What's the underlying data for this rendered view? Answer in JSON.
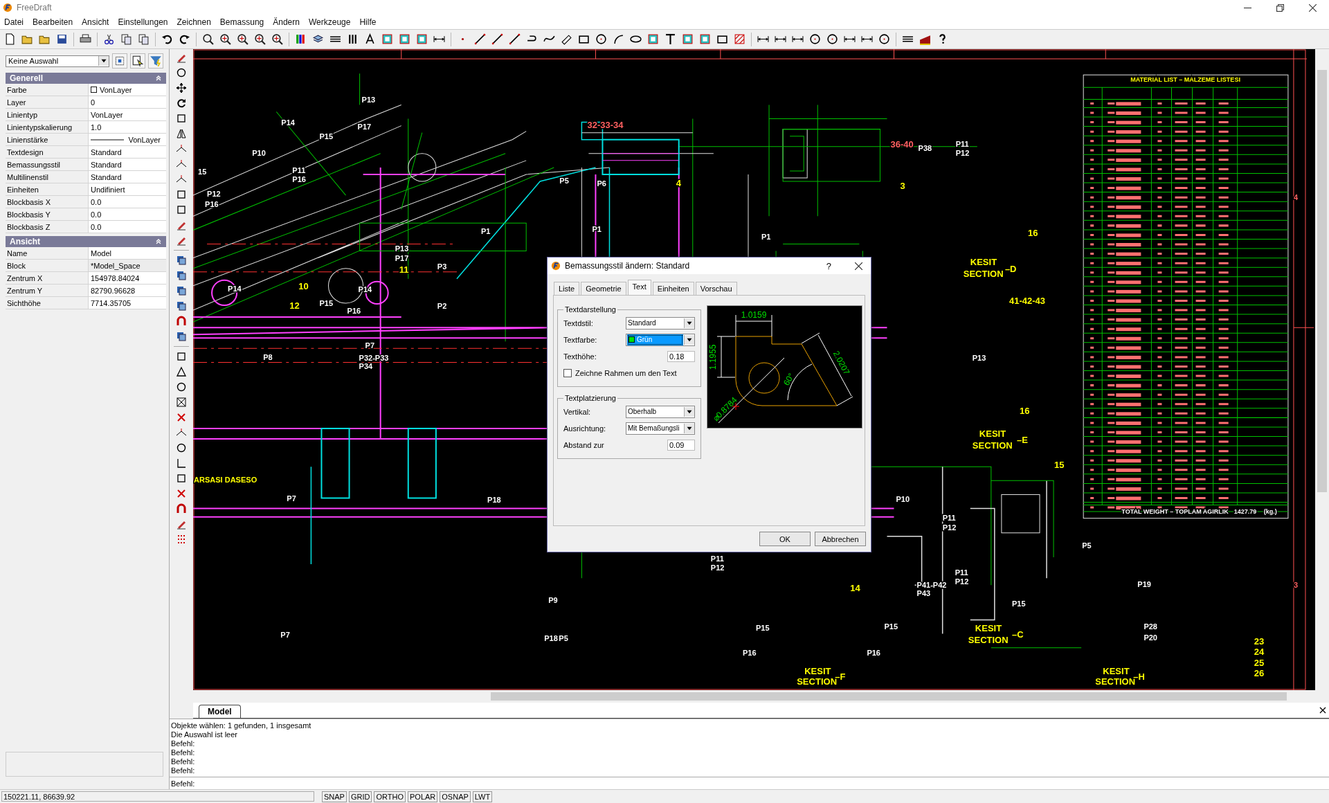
{
  "window": {
    "title": "FreeDraft"
  },
  "menu": [
    "Datei",
    "Bearbeiten",
    "Ansicht",
    "Einstellungen",
    "Zeichnen",
    "Bemassung",
    "Ändern",
    "Werkzeuge",
    "Hilfe"
  ],
  "selection_dropdown": {
    "value": "Keine Auswahl"
  },
  "properties": {
    "sections": [
      {
        "title": "Generell",
        "expanded": true,
        "rows": [
          {
            "label": "Farbe",
            "value": "VonLayer",
            "kind": "color"
          },
          {
            "label": "Layer",
            "value": "0",
            "kind": "text"
          },
          {
            "label": "Linientyp",
            "value": "VonLayer",
            "kind": "text"
          },
          {
            "label": "Linientypskalierung",
            "value": "1.0",
            "kind": "text"
          },
          {
            "label": "Linienstärke",
            "value": "VonLayer",
            "kind": "lineweight"
          },
          {
            "label": "Textdesign",
            "value": "Standard",
            "kind": "text"
          },
          {
            "label": "Bemassungsstil",
            "value": "Standard",
            "kind": "text"
          },
          {
            "label": "Multilinenstil",
            "value": "Standard",
            "kind": "text"
          },
          {
            "label": "Einheiten",
            "value": "Undifiniert",
            "kind": "text"
          },
          {
            "label": "Blockbasis X",
            "value": "0.0",
            "kind": "text"
          },
          {
            "label": "Blockbasis Y",
            "value": "0.0",
            "kind": "text"
          },
          {
            "label": "Blockbasis Z",
            "value": "0.0",
            "kind": "text"
          }
        ]
      },
      {
        "title": "Ansicht",
        "expanded": true,
        "rows": [
          {
            "label": "Name",
            "value": "Model",
            "kind": "text"
          },
          {
            "label": "Block",
            "value": "*Model_Space",
            "kind": "readonly"
          },
          {
            "label": "Zentrum X",
            "value": "154978.84024",
            "kind": "text"
          },
          {
            "label": "Zentrum Y",
            "value": "82790.96628",
            "kind": "text"
          },
          {
            "label": "Sichthöhe",
            "value": "7714.35705",
            "kind": "text"
          }
        ]
      }
    ]
  },
  "drawing": {
    "labels": [
      {
        "text": "32-33-34",
        "color": "#ff6060"
      },
      {
        "text": "36-40",
        "color": "#ff6060"
      },
      {
        "text": "41-42-43",
        "color": "#ffff00"
      },
      {
        "text": "MATERIAL LIST – MALZEME LISTESI",
        "color": "#ffff00"
      },
      {
        "text": "TOTAL WEIGHT – TOPLAM AGIRLIK",
        "color": "#ffffff"
      },
      {
        "text": "1427.79",
        "color": "#ffffff"
      },
      {
        "text": "(kg.)",
        "color": "#ffffff"
      },
      {
        "text": "KESIT",
        "color": "#ffff00"
      },
      {
        "text": "SECTION",
        "color": "#ffff00"
      },
      {
        "text": "–D",
        "color": "#ffff00"
      },
      {
        "text": "KESIT",
        "color": "#ffff00"
      },
      {
        "text": "SECTION",
        "color": "#ffff00"
      },
      {
        "text": "–E",
        "color": "#ffff00"
      },
      {
        "text": "KESIT",
        "color": "#ffff00"
      },
      {
        "text": "SECTION",
        "color": "#ffff00"
      },
      {
        "text": "–C",
        "color": "#ffff00"
      },
      {
        "text": "KESIT",
        "color": "#ffff00"
      },
      {
        "text": "SECTION",
        "color": "#ffff00"
      },
      {
        "text": "–F",
        "color": "#ffff00"
      },
      {
        "text": "KESIT",
        "color": "#ffff00"
      },
      {
        "text": "SECTION",
        "color": "#ffff00"
      },
      {
        "text": "–H",
        "color": "#ffff00"
      },
      {
        "text": "P13",
        "color": "#ffffff"
      },
      {
        "text": "P14",
        "color": "#ffffff"
      },
      {
        "text": "P15",
        "color": "#ffffff"
      },
      {
        "text": "P17",
        "color": "#ffffff"
      },
      {
        "text": "P10",
        "color": "#ffffff"
      },
      {
        "text": "P11",
        "color": "#ffffff"
      },
      {
        "text": "P16",
        "color": "#ffffff"
      },
      {
        "text": "P12",
        "color": "#ffffff"
      },
      {
        "text": "P16",
        "color": "#ffffff"
      },
      {
        "text": "P5",
        "color": "#ffffff"
      },
      {
        "text": "P6",
        "color": "#ffffff"
      },
      {
        "text": "P1",
        "color": "#ffffff"
      },
      {
        "text": "P1",
        "color": "#ffffff"
      },
      {
        "text": "P3",
        "color": "#ffffff"
      },
      {
        "text": "P13",
        "color": "#ffffff"
      },
      {
        "text": "P17",
        "color": "#ffffff"
      },
      {
        "text": "P14",
        "color": "#ffffff"
      },
      {
        "text": "P14",
        "color": "#ffffff"
      },
      {
        "text": "P15",
        "color": "#ffffff"
      },
      {
        "text": "P16",
        "color": "#ffffff"
      },
      {
        "text": "P2",
        "color": "#ffffff"
      },
      {
        "text": "P7",
        "color": "#ffffff"
      },
      {
        "text": "P8",
        "color": "#ffffff"
      },
      {
        "text": "P32-P33",
        "color": "#ffffff"
      },
      {
        "text": "P34",
        "color": "#ffffff"
      },
      {
        "text": "P1",
        "color": "#ffffff"
      },
      {
        "text": "P38",
        "color": "#ffffff"
      },
      {
        "text": "P11",
        "color": "#ffffff"
      },
      {
        "text": "P12",
        "color": "#ffffff"
      },
      {
        "text": "P13",
        "color": "#ffffff"
      },
      {
        "text": "P7",
        "color": "#ffffff"
      },
      {
        "text": "P18",
        "color": "#ffffff"
      },
      {
        "text": "P9",
        "color": "#ffffff"
      },
      {
        "text": "P7",
        "color": "#ffffff"
      },
      {
        "text": "P18",
        "color": "#ffffff"
      },
      {
        "text": "P5",
        "color": "#ffffff"
      },
      {
        "text": "P10",
        "color": "#ffffff"
      },
      {
        "text": "P11",
        "color": "#ffffff"
      },
      {
        "text": "P12",
        "color": "#ffffff"
      },
      {
        "text": "P11",
        "color": "#ffffff"
      },
      {
        "text": "P12",
        "color": "#ffffff"
      },
      {
        "text": "P41-P42",
        "color": "#ffffff"
      },
      {
        "text": "P43",
        "color": "#ffffff"
      },
      {
        "text": "P15",
        "color": "#ffffff"
      },
      {
        "text": "P16",
        "color": "#ffffff"
      },
      {
        "text": "P15",
        "color": "#ffffff"
      },
      {
        "text": "P16",
        "color": "#ffffff"
      },
      {
        "text": "P11",
        "color": "#ffffff"
      },
      {
        "text": "P12",
        "color": "#ffffff"
      },
      {
        "text": "P15",
        "color": "#ffffff"
      },
      {
        "text": "P5",
        "color": "#ffffff"
      },
      {
        "text": "P19",
        "color": "#ffffff"
      },
      {
        "text": "P28",
        "color": "#ffffff"
      },
      {
        "text": "P20",
        "color": "#ffffff"
      },
      {
        "text": "4",
        "color": "#ffff00"
      },
      {
        "text": "3",
        "color": "#ffff00"
      },
      {
        "text": "16",
        "color": "#ffff00"
      },
      {
        "text": "11",
        "color": "#ffff00"
      },
      {
        "text": "10",
        "color": "#ffff00"
      },
      {
        "text": "12",
        "color": "#ffff00"
      },
      {
        "text": "16",
        "color": "#ffff00"
      },
      {
        "text": "15",
        "color": "#ffff00"
      },
      {
        "text": "14",
        "color": "#ffff00"
      },
      {
        "text": "23",
        "color": "#ffff00"
      },
      {
        "text": "24",
        "color": "#ffff00"
      },
      {
        "text": "25",
        "color": "#ffff00"
      },
      {
        "text": "26",
        "color": "#ffff00"
      },
      {
        "text": "4",
        "color": "#ff6060"
      },
      {
        "text": "3",
        "color": "#ff6060"
      },
      {
        "text": "15",
        "color": "#ffffff"
      },
      {
        "text": "ARSASI DASESO",
        "color": "#ffff00"
      }
    ]
  },
  "layout_tabs": [
    {
      "label": "Model",
      "selected": true
    }
  ],
  "command_history": [
    "Objekte wählen: 1 gefunden, 1 insgesamt",
    "Die Auswahl ist leer",
    "Befehl:",
    "Befehl:",
    "Befehl:",
    "Befehl:"
  ],
  "command_prompt": "Befehl:",
  "coordinates": "150221.11,  86639.92",
  "status_toggles": [
    "SNAP",
    "GRID",
    "ORTHO",
    "POLAR",
    "OSNAP",
    "LWT"
  ],
  "dialog": {
    "title": "Bemassungsstil ändern: Standard",
    "help_button": "?",
    "tabs": [
      {
        "label": "Liste",
        "selected": false
      },
      {
        "label": "Geometrie",
        "selected": false
      },
      {
        "label": "Text",
        "selected": true
      },
      {
        "label": "Einheiten",
        "selected": false
      },
      {
        "label": "Vorschau",
        "selected": false
      }
    ],
    "groups": [
      {
        "title": "Textdarstellung",
        "fields": [
          {
            "kind": "dropdown",
            "label": "Textdstil:",
            "value": "Standard"
          },
          {
            "kind": "color-dropdown",
            "label": "Textfarbe:",
            "value": "Grün"
          },
          {
            "kind": "number",
            "label": "Texthöhe:",
            "value": "0.18"
          },
          {
            "kind": "checkbox",
            "label": "Zeichne Rahmen um den Text",
            "checked": false
          }
        ]
      },
      {
        "title": "Textplatzierung",
        "fields": [
          {
            "kind": "dropdown",
            "label": "Vertikal:",
            "value": "Oberhalb"
          },
          {
            "kind": "dropdown",
            "label": "Ausrichtung:",
            "value": "Mit Bemaßungsli"
          },
          {
            "kind": "number",
            "label": "Abstand zur",
            "value": "0.09"
          }
        ]
      }
    ],
    "preview_labels": [
      "1.0159",
      "1.1955",
      "2.0207",
      "60°",
      "⌀0.8784"
    ],
    "buttons": [
      "OK",
      "Abbrechen"
    ]
  }
}
